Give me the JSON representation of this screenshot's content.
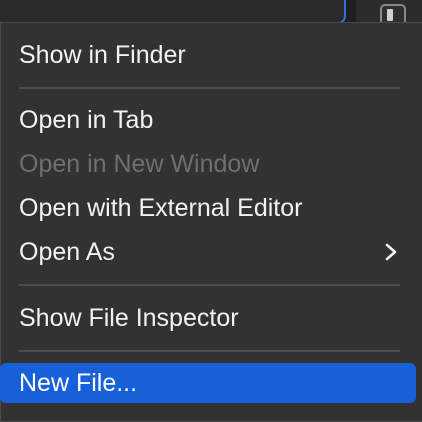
{
  "menu": {
    "items": [
      {
        "label": "Show in Finder",
        "state": "enabled"
      },
      {
        "label": "Open in Tab",
        "state": "enabled"
      },
      {
        "label": "Open in New Window",
        "state": "disabled"
      },
      {
        "label": "Open with External Editor",
        "state": "enabled"
      },
      {
        "label": "Open As",
        "state": "enabled",
        "submenu": true
      },
      {
        "label": "Show File Inspector",
        "state": "enabled"
      },
      {
        "label": "New File...",
        "state": "highlighted"
      }
    ]
  },
  "colors": {
    "menu_background": "#323232",
    "highlight": "#1760d8",
    "text": "#f2f2f2",
    "disabled_text": "#6f6f6f",
    "separator": "#4d4d4d",
    "focus_ring": "#2f6fe0"
  },
  "icons": {
    "submenu": "chevron-right-icon",
    "panel_toggle": "sidebar-toggle-icon"
  }
}
